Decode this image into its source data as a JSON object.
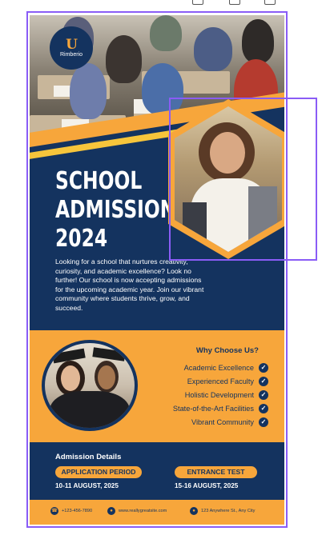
{
  "brand": {
    "logo_mark": "U",
    "logo_name": "Rimberio"
  },
  "hero": {
    "title_line1": "SCHOOL",
    "title_line2": "ADMISSION",
    "title_line3": "2024"
  },
  "intro_text": "Looking for a school that nurtures creativity, curiosity, and academic excellence? Look no further! Our school is now accepting admissions for the upcoming academic year. Join our vibrant community where students thrive, grow, and succeed.",
  "why": {
    "title": "Why Choose Us?",
    "items": [
      {
        "label": "Academic Excellence",
        "icon": "check-circle"
      },
      {
        "label": "Experienced Faculty",
        "icon": "check-circle"
      },
      {
        "label": "Holistic Development",
        "icon": "check-circle"
      },
      {
        "label": "State-of-the-Art Facilities",
        "icon": "check-circle"
      },
      {
        "label": "Vibrant Community",
        "icon": "check-circle"
      }
    ]
  },
  "admission": {
    "title": "Admission Details",
    "application_label": "APPLICATION PERIOD",
    "application_date": "10-11 AUGUST, 2025",
    "test_label": "ENTRANCE TEST",
    "test_date": "15-16 AUGUST, 2025"
  },
  "footer": {
    "phone": "+123-456-7890",
    "website": "www.reallygreatsite.com",
    "address": "123 Anywhere St., Any City"
  },
  "colors": {
    "navy": "#14335f",
    "orange": "#f7a63b",
    "selection": "#8a5cf6"
  }
}
